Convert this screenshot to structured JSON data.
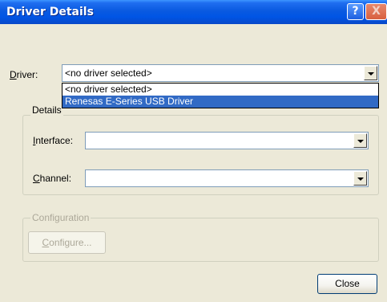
{
  "window": {
    "title": "Driver Details",
    "help_glyph": "?",
    "close_glyph": "X"
  },
  "driver": {
    "label_mnemonic": "D",
    "label_rest": "river:",
    "selected": "<no driver selected>",
    "options": [
      "<no driver selected>",
      "Renesas E-Series USB Driver"
    ],
    "highlighted_index": 1
  },
  "details_group": {
    "title": "Details",
    "interface": {
      "label_mnemonic": "I",
      "label_rest": "nterface:",
      "value": ""
    },
    "channel": {
      "label_mnemonic": "C",
      "label_rest": "hannel:",
      "value": ""
    }
  },
  "configuration_group": {
    "title": "Configuration",
    "configure_button": {
      "mnemonic": "C",
      "rest": "onfigure..."
    }
  },
  "footer": {
    "close_button": "Close"
  },
  "colors": {
    "titlebar": "#0055e5",
    "dialog_bg": "#ece9d8",
    "selection": "#316ac5",
    "disabled_text": "#aca899"
  }
}
